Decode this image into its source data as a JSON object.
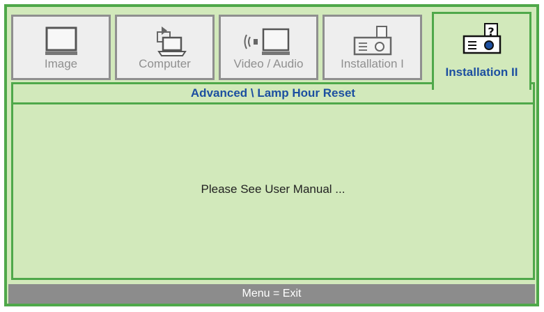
{
  "tabs": [
    {
      "label": "Image",
      "icon": "monitor-icon",
      "active": false
    },
    {
      "label": "Computer",
      "icon": "laptop-icon",
      "active": false
    },
    {
      "label": "Video / Audio",
      "icon": "speaker-screen-icon",
      "active": false
    },
    {
      "label": "Installation I",
      "icon": "projector-icon",
      "active": false
    },
    {
      "label": "Installation II",
      "icon": "projector-question-icon",
      "active": true
    }
  ],
  "breadcrumb": "Advanced \\ Lamp Hour Reset",
  "message": "Please See User Manual ...",
  "footer": "Menu = Exit",
  "colors": {
    "accent": "#4fa84a",
    "panel": "#d2e9bb",
    "active_text": "#1c4fa0",
    "inactive": "#8f8f8f",
    "footer": "#8c8c8c"
  }
}
